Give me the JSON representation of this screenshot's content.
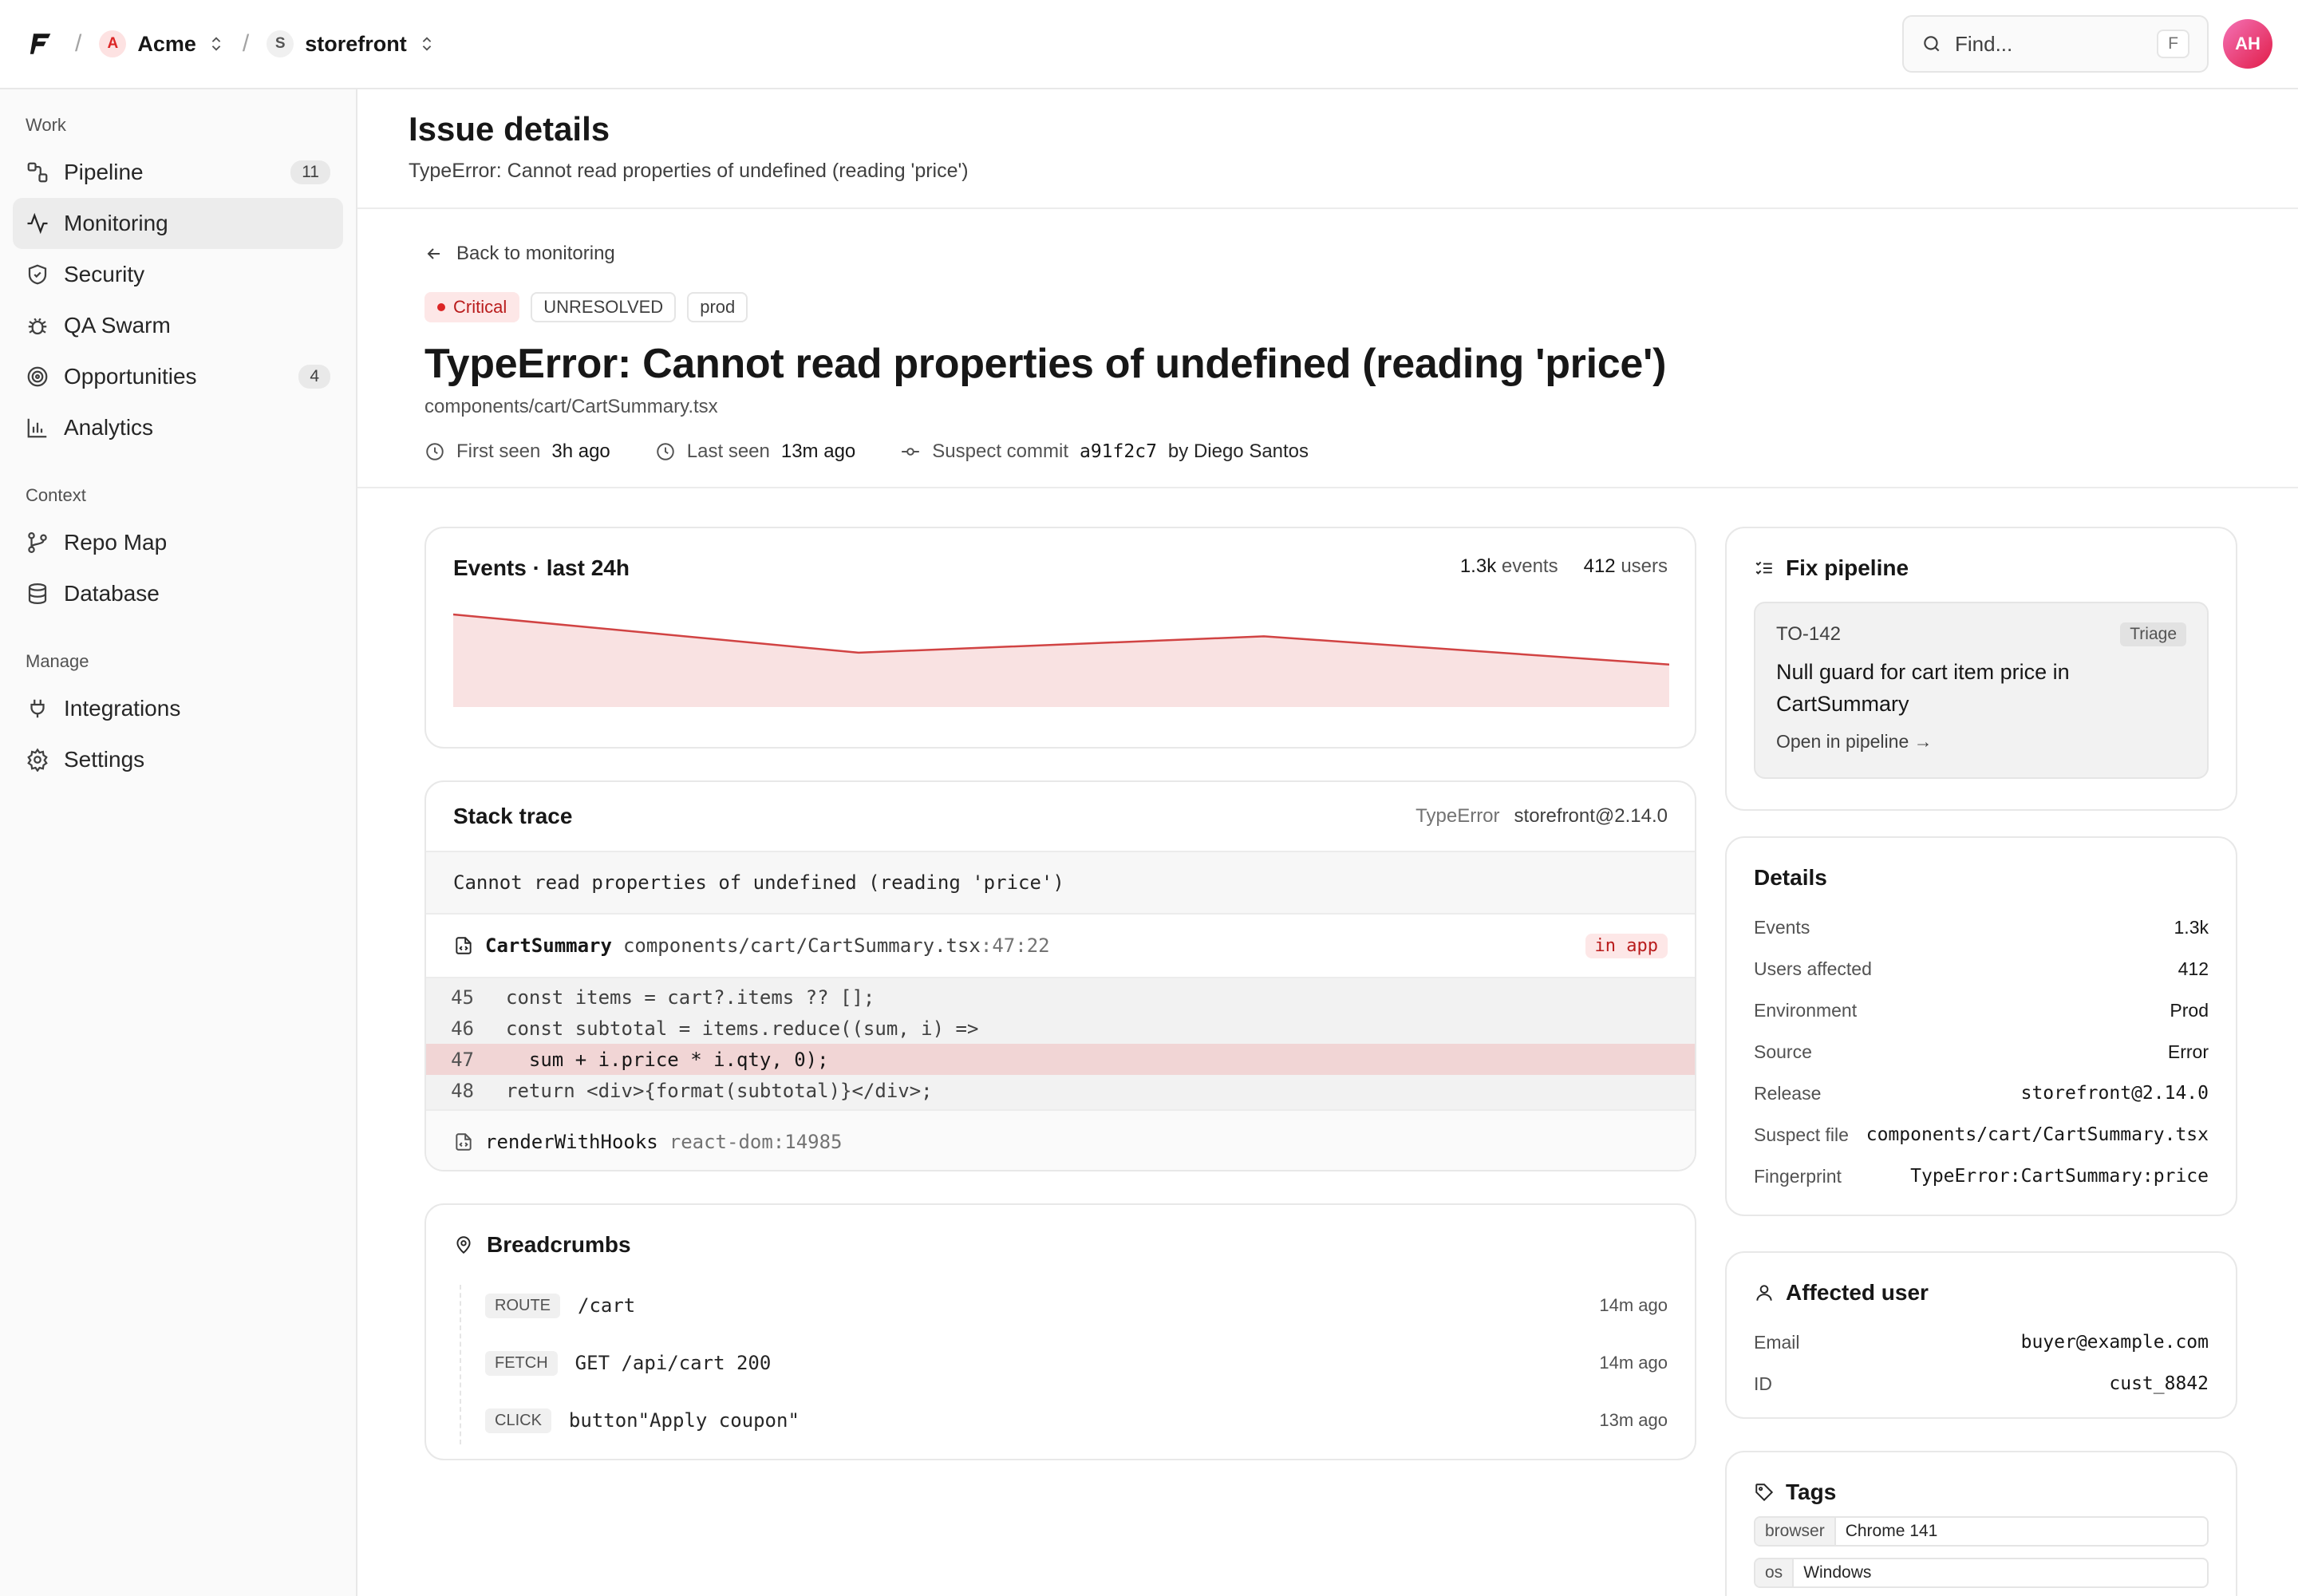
{
  "topbar": {
    "org": {
      "initial": "A",
      "name": "Acme"
    },
    "project": {
      "initial": "S",
      "name": "storefront"
    },
    "search": {
      "placeholder": "Find...",
      "shortcut": "F"
    },
    "user_initials": "AH"
  },
  "sidebar": {
    "sections": [
      {
        "title": "Work",
        "items": [
          {
            "label": "Pipeline",
            "count": "11",
            "icon": "pipeline-icon"
          },
          {
            "label": "Monitoring",
            "active": true,
            "icon": "activity-icon"
          },
          {
            "label": "Security",
            "icon": "shield-icon"
          },
          {
            "label": "QA Swarm",
            "icon": "bug-icon"
          },
          {
            "label": "Opportunities",
            "count": "4",
            "icon": "target-icon"
          },
          {
            "label": "Analytics",
            "icon": "bar-chart-icon"
          }
        ]
      },
      {
        "title": "Context",
        "items": [
          {
            "label": "Repo Map",
            "icon": "git-branch-icon"
          },
          {
            "label": "Database",
            "icon": "database-icon"
          }
        ]
      },
      {
        "title": "Manage",
        "items": [
          {
            "label": "Integrations",
            "icon": "plug-icon"
          },
          {
            "label": "Settings",
            "icon": "gear-icon"
          }
        ]
      }
    ]
  },
  "page": {
    "title": "Issue details",
    "subtitle": "TypeError: Cannot read properties of undefined (reading 'price')"
  },
  "issue": {
    "back_label": "Back to monitoring",
    "severity": "Critical",
    "status": "UNRESOLVED",
    "env": "prod",
    "title": "TypeError: Cannot read properties of undefined (reading 'price')",
    "file": "components/cart/CartSummary.tsx",
    "first_seen_label": "First seen",
    "first_seen": "3h ago",
    "last_seen_label": "Last seen",
    "last_seen": "13m ago",
    "commit_label": "Suspect commit",
    "commit": "a91f2c7",
    "author": "by Diego Santos"
  },
  "events": {
    "title": "Events · last 24h",
    "events_count": "1.3k",
    "events_label": "events",
    "users_count": "412",
    "users_label": "users"
  },
  "chart_data": {
    "type": "area",
    "title": "Events · last 24h",
    "x": [
      0,
      1,
      2,
      3
    ],
    "values": [
      1.0,
      0.58,
      0.76,
      0.45
    ],
    "fill": "#f9e2e2",
    "stroke": "#d14343"
  },
  "stack": {
    "title": "Stack trace",
    "error_type": "TypeError",
    "release": "storefront@2.14.0",
    "message": "Cannot read properties of undefined (reading 'price')",
    "frame1": {
      "fn": "CartSummary",
      "path": "components/cart/CartSummary.tsx",
      "loc": ":47:22",
      "badge": "in app"
    },
    "code": [
      {
        "num": "45",
        "text": "const items = cart?.items ?? [];"
      },
      {
        "num": "46",
        "text": "const subtotal = items.reduce((sum, i) =>"
      },
      {
        "num": "47",
        "text": "  sum + i.price * i.qty, 0);"
      },
      {
        "num": "48",
        "text": "return <div>{format(subtotal)}</div>;"
      }
    ],
    "frame2": {
      "fn": "renderWithHooks",
      "path": "react-dom:14985"
    }
  },
  "breadcrumbs": {
    "title": "Breadcrumbs",
    "items": [
      {
        "type": "ROUTE",
        "value": "/cart",
        "time": "14m ago"
      },
      {
        "type": "FETCH",
        "value": "GET /api/cart 200",
        "time": "14m ago"
      },
      {
        "type": "CLICK",
        "value": "button\"Apply coupon\"",
        "time": "13m ago"
      }
    ]
  },
  "fix": {
    "title": "Fix pipeline",
    "ticket": "TO-142",
    "stage": "Triage",
    "desc": "Null guard for cart item price in CartSummary",
    "link": "Open in pipeline →"
  },
  "details": {
    "title": "Details",
    "rows": [
      {
        "k": "Events",
        "v": "1.3k"
      },
      {
        "k": "Users affected",
        "v": "412"
      },
      {
        "k": "Environment",
        "v": "Prod"
      },
      {
        "k": "Source",
        "v": "Error"
      },
      {
        "k": "Release",
        "v": "storefront@2.14.0"
      },
      {
        "k": "Suspect file",
        "v": "components/cart/CartSummary.tsx"
      },
      {
        "k": "Fingerprint",
        "v": "TypeError:CartSummary:price"
      }
    ]
  },
  "affected": {
    "title": "Affected user",
    "email_label": "Email",
    "email": "buyer@example.com",
    "id_label": "ID",
    "id": "cust_8842"
  },
  "tags": {
    "title": "Tags",
    "items": [
      {
        "k": "browser",
        "v": "Chrome 141"
      },
      {
        "k": "os",
        "v": "Windows"
      }
    ]
  }
}
